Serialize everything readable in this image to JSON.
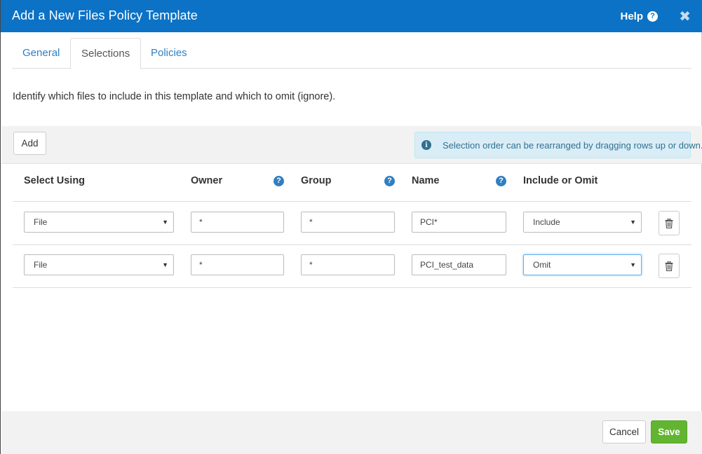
{
  "dialog": {
    "title": "Add a New Files Policy Template",
    "help_label": "Help",
    "help_icon": "question-circle-icon",
    "close_icon": "close-icon",
    "close_glyph": "✖",
    "header_color": "#0c72c5"
  },
  "tabs": [
    {
      "label": "General",
      "active": false
    },
    {
      "label": "Selections",
      "active": true
    },
    {
      "label": "Policies",
      "active": false
    }
  ],
  "intro": "Identify which files to include in this template and which to omit (ignore).",
  "toolbar": {
    "add_label": "Add",
    "info_icon": "info-circle-icon",
    "info_message": "Selection order can be rearranged by dragging rows up or down."
  },
  "table": {
    "headers": {
      "select_using": "Select Using",
      "owner": "Owner",
      "group": "Group",
      "name": "Name",
      "include_omit": "Include or Omit"
    },
    "rows": [
      {
        "select_using": "File",
        "owner": "*",
        "group": "*",
        "name": "PCI*",
        "include_omit": "Include"
      },
      {
        "select_using": "File",
        "owner": "*",
        "group": "*",
        "name": "PCI_test_data",
        "include_omit": "Omit"
      }
    ]
  },
  "footer": {
    "cancel_label": "Cancel",
    "save_label": "Save",
    "save_color": "#62b530"
  },
  "glyphs": {
    "question": "?",
    "info": "i",
    "caret": "▼"
  }
}
